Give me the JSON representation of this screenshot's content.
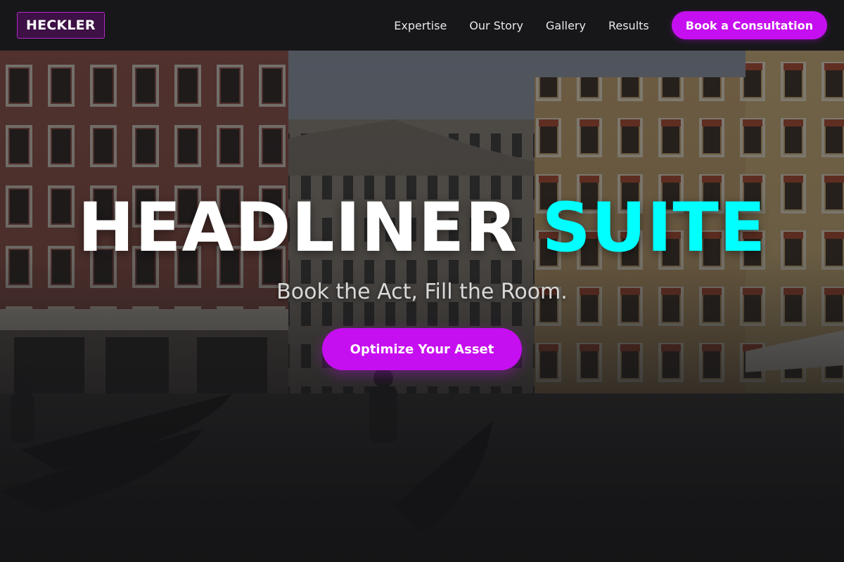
{
  "brand": {
    "name": "HECKLER"
  },
  "nav": {
    "links": [
      "Expertise",
      "Our Story",
      "Gallery",
      "Results"
    ],
    "cta_label": "Book a Consultation"
  },
  "hero": {
    "title_main": "HEADLINER",
    "title_accent": "SUITE",
    "subtitle": "Book the Act, Fill the Room.",
    "cta_label": "Optimize Your Asset"
  },
  "colors": {
    "accent_purple": "#c60ff0",
    "accent_cyan": "#00ffff",
    "navbar_bg": "#161618",
    "logo_bg": "#3d1046"
  }
}
